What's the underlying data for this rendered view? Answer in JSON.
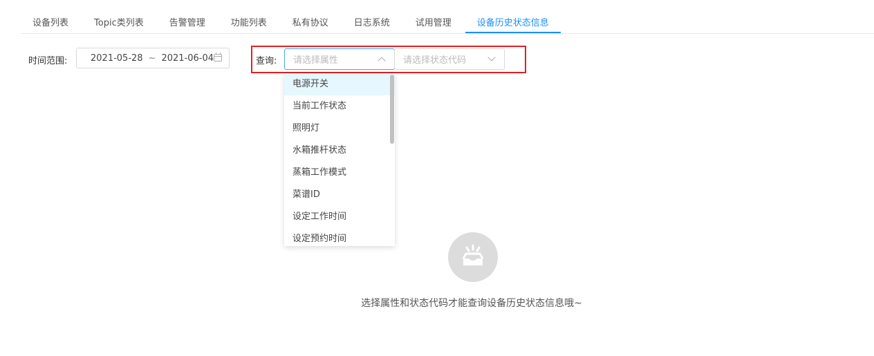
{
  "tabs": [
    {
      "label": "设备列表"
    },
    {
      "label": "Topic类列表"
    },
    {
      "label": "告警管理"
    },
    {
      "label": "功能列表"
    },
    {
      "label": "私有协议"
    },
    {
      "label": "日志系统"
    },
    {
      "label": "试用管理"
    },
    {
      "label": "设备历史状态信息",
      "active": true
    }
  ],
  "filter": {
    "time_label": "时间范围:",
    "date_start": "2021-05-28",
    "date_separator": "~",
    "date_end": "2021-06-04",
    "query_label": "查询:",
    "attribute_placeholder": "请选择属性",
    "status_code_placeholder": "请选择状态代码"
  },
  "dropdown": {
    "options": [
      "电源开关",
      "当前工作状态",
      "照明灯",
      "水箱推杆状态",
      "蒸箱工作模式",
      "菜谱ID",
      "设定工作时间",
      "设定预约时间"
    ],
    "selected_index": 0
  },
  "empty_state": {
    "message": "选择属性和状态代码才能查询设备历史状态信息哦~",
    "icon": "empty-box-icon"
  },
  "colors": {
    "accent": "#1890ff",
    "highlight": "#e02020"
  }
}
